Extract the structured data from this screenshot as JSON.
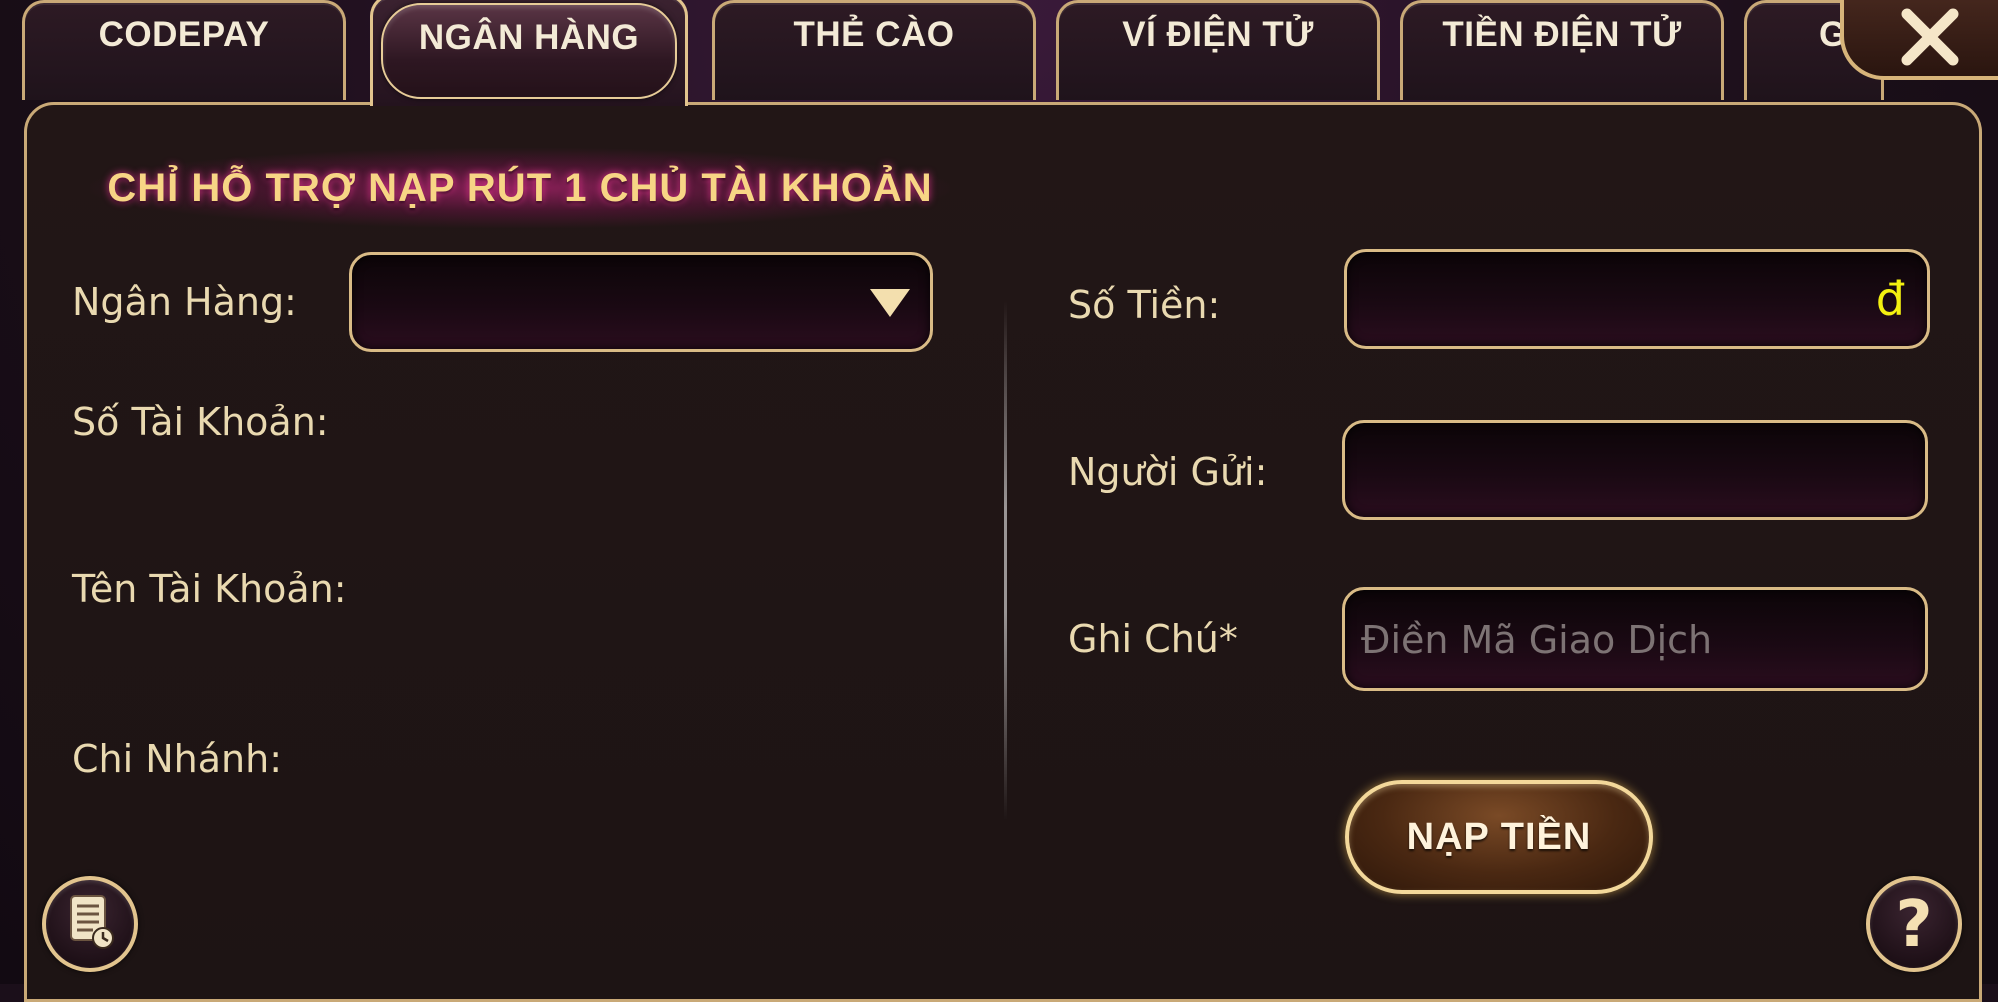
{
  "tabs": [
    {
      "label": "CODEPAY",
      "active": false
    },
    {
      "label": "NGÂN HÀNG",
      "active": true
    },
    {
      "label": "THẺ CÀO",
      "active": false
    },
    {
      "label": "VÍ ĐIỆN TỬ",
      "active": false
    },
    {
      "label": "TIỀN ĐIỆN TỬ",
      "active": false
    },
    {
      "label": "G",
      "active": false
    }
  ],
  "close_icon": "close-icon",
  "banner": {
    "text": "CHỈ HỖ TRỢ NẠP RÚT 1 CHỦ TÀI KHOẢN"
  },
  "left": {
    "bank_label": "Ngân Hàng:",
    "bank_value": "",
    "account_number_label": "Số Tài Khoản:",
    "account_name_label": "Tên Tài Khoản:",
    "branch_label": "Chi Nhánh:"
  },
  "right": {
    "amount_label": "Số Tiền:",
    "amount_value": "",
    "currency_symbol": "đ",
    "sender_label": "Người Gửi:",
    "sender_value": "",
    "note_label": "Ghi Chú*",
    "note_placeholder": "Điền Mã Giao Dịch",
    "submit_label": "NẠP TIỀN"
  },
  "icons": {
    "history": "history-document-icon",
    "help": "help-icon"
  },
  "help_glyph": "?",
  "colors": {
    "accent_gold": "#d9bb86",
    "label": "#e9d9b0",
    "currency": "#f3f010",
    "banner_text": "#f7d585"
  }
}
